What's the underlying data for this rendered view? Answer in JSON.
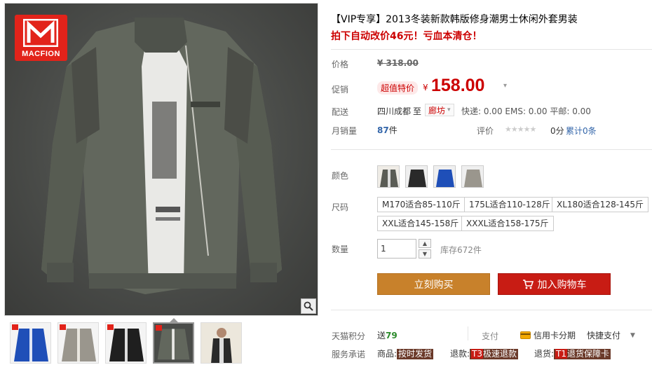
{
  "brand": {
    "logo_text": "MACFION",
    "accent": "#e2231a"
  },
  "product": {
    "title": "【VIP专享】2013冬装新款韩版修身潮男士休闲外套男装",
    "subtitle": "拍下自动改价46元！亏血本清仓！"
  },
  "price": {
    "label": "价格",
    "original": "¥ 318.00",
    "promo_label": "促销",
    "promo_tag": "超值特价",
    "currency": "¥",
    "promo_value": "158.00"
  },
  "shipping": {
    "label": "配送",
    "from": "四川成都",
    "to_word": "至",
    "destination": "廊坊",
    "fees": "快递: 0.00 EMS: 0.00 平邮: 0.00"
  },
  "sales": {
    "label": "月销量",
    "count": "87",
    "unit": "件",
    "rating_label": "评价",
    "score": "0分",
    "reviews": "累计0条"
  },
  "color": {
    "label": "颜色",
    "swatches": [
      {
        "name": "green-print",
        "color": "#5a5c55"
      },
      {
        "name": "black",
        "color": "#2a2a2a"
      },
      {
        "name": "blue",
        "color": "#1f4fb8"
      },
      {
        "name": "khaki",
        "color": "#9a968d"
      }
    ]
  },
  "size": {
    "label": "尺码",
    "options": [
      "M170适合85-110斤",
      "175L适合110-128斤",
      "XL180适合128-145斤",
      "XXL适合145-158斤",
      "XXXL适合158-175斤"
    ]
  },
  "quantity": {
    "label": "数量",
    "value": "1",
    "stock": "库存672件"
  },
  "actions": {
    "buy_now": "立刻购买",
    "add_to_cart": "加入购物车"
  },
  "points": {
    "label": "天猫积分",
    "prefix": "送",
    "value": "79",
    "pay_label": "支付",
    "credit_card": "信用卡分期",
    "quick_pay": "快捷支付"
  },
  "services": {
    "label": "服务承诺",
    "goods_label": "商品:",
    "goods_tag": "按时发货",
    "refund_label": "退款:",
    "refund_code": "T3",
    "refund_tag": "极速退款",
    "return_label": "退货:",
    "return_code": "T1",
    "return_tag": "退货保障卡"
  },
  "thumbnails": [
    {
      "name": "blue-jacket",
      "color": "#1f4fb8"
    },
    {
      "name": "khaki-jacket",
      "color": "#9a968d"
    },
    {
      "name": "black-jacket",
      "color": "#1f1f1f"
    },
    {
      "name": "green-jacket",
      "color": "#555a52"
    },
    {
      "name": "model-photo",
      "color": "#d9d0c2"
    }
  ]
}
